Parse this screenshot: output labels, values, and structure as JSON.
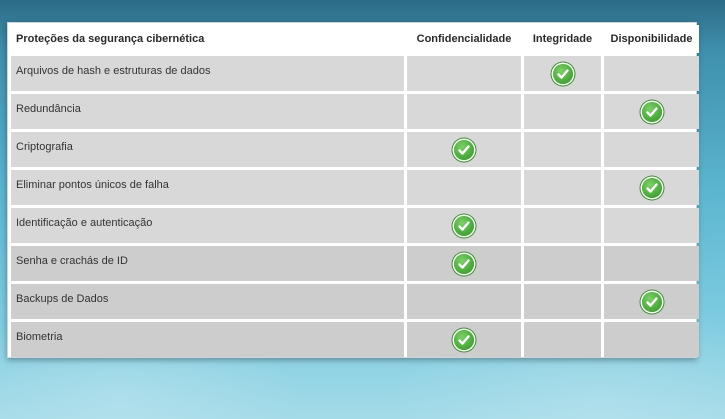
{
  "table": {
    "headers": [
      "Proteções da segurança cibernética",
      "Confidencialidade",
      "Integridade",
      "Disponibilidade"
    ],
    "rows": [
      {
        "label": "Arquivos de hash e estruturas de dados",
        "checks": [
          false,
          true,
          false
        ]
      },
      {
        "label": "Redundância",
        "checks": [
          false,
          false,
          true
        ]
      },
      {
        "label": "Criptografia",
        "checks": [
          true,
          false,
          false
        ]
      },
      {
        "label": "Eliminar pontos únicos de falha",
        "checks": [
          false,
          false,
          true
        ]
      },
      {
        "label": "Identificação e autenticação",
        "checks": [
          true,
          false,
          false
        ]
      },
      {
        "label": "Senha e crachás de ID",
        "checks": [
          true,
          false,
          false
        ]
      },
      {
        "label": "Backups de Dados",
        "checks": [
          false,
          false,
          true
        ]
      },
      {
        "label": "Biometria",
        "checks": [
          true,
          false,
          false
        ]
      }
    ]
  },
  "icons": {
    "check": "checkmark-icon"
  },
  "colors": {
    "check_fill": "#4fae3f",
    "cell_bg": "#d8d8d8",
    "cell_bg_alt": "#cdcdcd"
  }
}
